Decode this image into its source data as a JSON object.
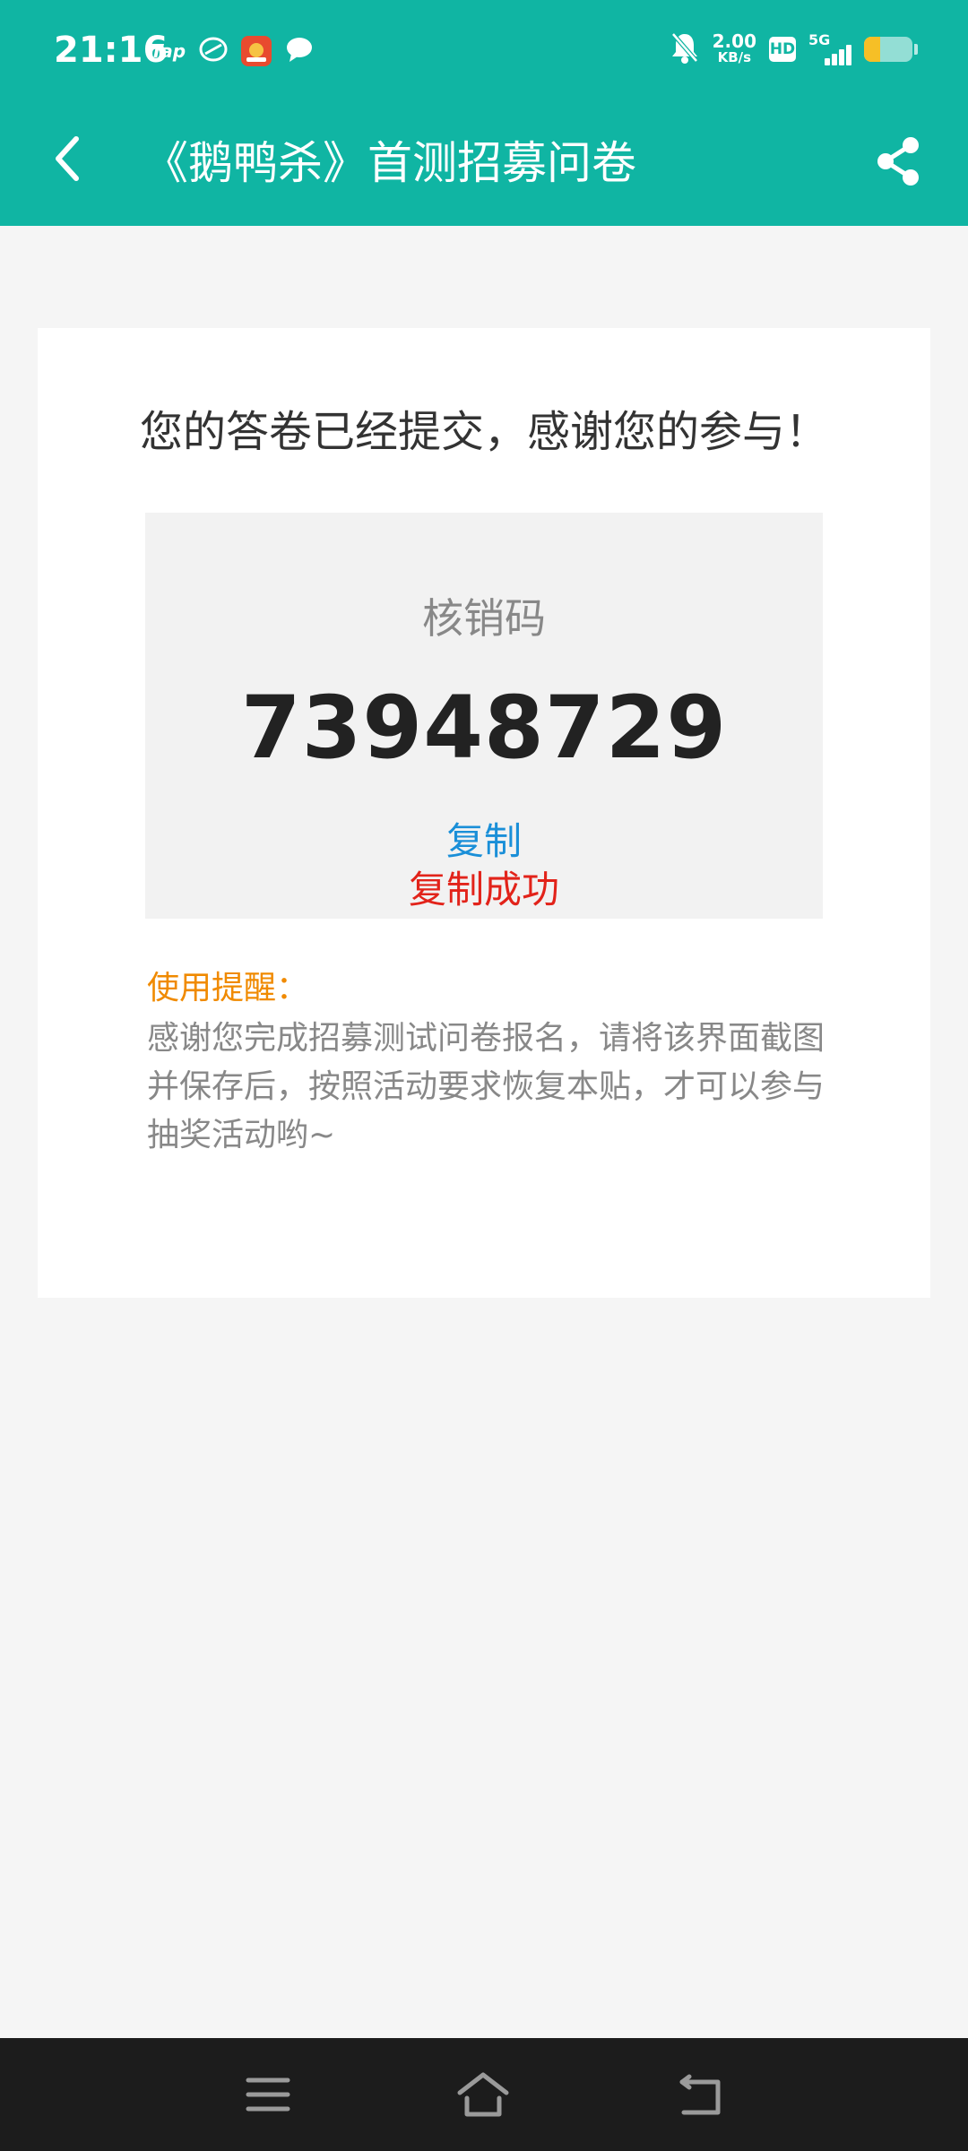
{
  "status_bar": {
    "time": "21:16",
    "tap_label": "Tap",
    "net_speed_value": "2.00",
    "net_speed_unit": "KB/s",
    "hd_label": "HD",
    "network_label": "5G",
    "battery_level": 0.34
  },
  "header": {
    "title": "《鹅鸭杀》首测招募问卷",
    "bg_color": "#10b5a3"
  },
  "card": {
    "submitted_message": "您的答卷已经提交，感谢您的参与！",
    "code_label": "核销码",
    "code_value": "73948729",
    "copy_label": "复制",
    "copy_success": "复制成功",
    "reminder_title": "使用提醒：",
    "reminder_text": "感谢您完成招募测试问卷报名，请将该界面截图并保存后，按照活动要求恢复本贴，才可以参与抽奖活动哟~"
  },
  "nav_bar": {
    "icons": [
      "menu-icon",
      "home-icon",
      "back-icon"
    ]
  }
}
